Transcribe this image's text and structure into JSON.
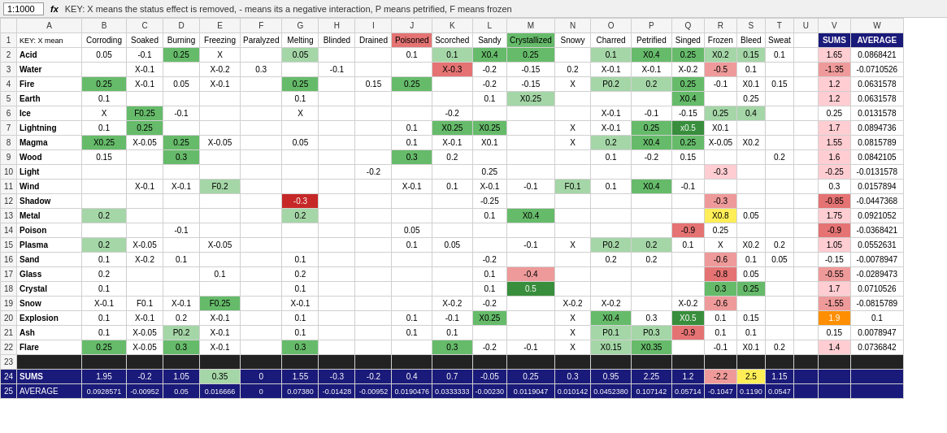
{
  "toolbar": {
    "zoom": "1:1000",
    "fx_label": "fx",
    "formula": "KEY: X means the status effect is removed, - means its a negative interaction, P means petrified, F means frozen"
  },
  "col_headers": [
    "",
    "A",
    "B",
    "C",
    "D",
    "E",
    "F",
    "G",
    "H",
    "I",
    "J",
    "K",
    "L",
    "M",
    "N",
    "O",
    "P",
    "Q",
    "R",
    "S",
    "T",
    "U",
    "V",
    "W"
  ],
  "row1_headers": [
    "KEY: X mean",
    "Corroding",
    "Soaked",
    "Burning",
    "Freezing",
    "Paralyzed",
    "Melting",
    "Blinded",
    "Drained",
    "Poisoned",
    "Scorched",
    "Sandy",
    "Crystallized",
    "Snowy",
    "Charred",
    "Petrified",
    "Singed",
    "Frozen",
    "Bleed",
    "Sweat",
    "",
    "SUMS",
    "AVERAGE"
  ],
  "rows": [
    {
      "num": 2,
      "label": "Acid",
      "cells": {
        "B": "0.05",
        "C": "-0.1",
        "D": "0.25",
        "E": "X",
        "G": "0.05",
        "J": "0.1",
        "K": "0.1",
        "L": "X.0.4",
        "M": "0.25",
        "O": "0.1",
        "P": "X0.4",
        "Q": "0.25",
        "R": "X0.2",
        "S": "0.15",
        "T": "0.1",
        "V": "1.65",
        "W": "0.0868421"
      },
      "colors": {
        "D": "g2",
        "G": "g1",
        "K": "g1",
        "L": "g2",
        "M": "g2",
        "O": "g1",
        "P": "g2",
        "Q": "g2",
        "R": "g1",
        "S": "g1"
      }
    },
    {
      "num": 3,
      "label": "Water",
      "cells": {
        "C": "X-0.1",
        "E": "X-0.2",
        "F": "0.3",
        "H": "-0.1",
        "K": "X-0.3",
        "L": "-0.2",
        "M": "-0.15",
        "N": "0.2",
        "O": "X-0.1",
        "P": "X-0.1",
        "Q": "X-0.2",
        "R": "-0.5",
        "S": "0.1",
        "V": "-1.35",
        "W": "-0.071052"
      },
      "colors": {
        "K": "r3",
        "R": "r2",
        "V": "r2"
      }
    },
    {
      "num": 4,
      "label": "Fire",
      "cells": {
        "B": "0.25",
        "C": "X-0.1",
        "D": "0.05",
        "E": "X-0.1",
        "G": "0.25",
        "I": "0.15",
        "J": "0.25",
        "L": "-0.2",
        "M": "-0.15",
        "N": "X",
        "O": "P0.2",
        "P": "0.2",
        "Q": "0.25",
        "R": "-0.1",
        "S": "X0.1",
        "T": "0.15",
        "V": "1.2",
        "W": "0.0631578"
      },
      "colors": {
        "B": "g2",
        "G": "g2",
        "J": "g2",
        "O": "g1",
        "P": "g1",
        "Q": "g2"
      }
    },
    {
      "num": 5,
      "label": "Earth",
      "cells": {
        "B": "0.1",
        "G": "0.1",
        "L": "0.1",
        "M": "X0.25",
        "Q": "X0.4",
        "S": "0.25",
        "V": "1.2",
        "W": "0.0631578"
      },
      "colors": {
        "M": "g1",
        "Q": "g2"
      }
    },
    {
      "num": 6,
      "label": "Ice",
      "cells": {
        "B": "X",
        "C": "F0.25",
        "D": "-0.1",
        "G": "X",
        "K": "-0.2",
        "O": "X-0.1",
        "P": "-0.1",
        "Q": "-0.15",
        "R": "0.25",
        "S": "0.4",
        "V": "0.25",
        "W": "0.0131578"
      },
      "colors": {
        "C": "g2",
        "R": "g2",
        "S": "g2"
      }
    },
    {
      "num": 7,
      "label": "Lightning",
      "cells": {
        "B": "0.1",
        "C": "0.25",
        "J": "0.1",
        "K": "X0.25",
        "L": "X0.25",
        "N": "X",
        "O": "X-0.1",
        "P": "0.25",
        "Q": "x0.5",
        "R": "X0.1",
        "V": "1.7",
        "W": "0.0894736"
      },
      "colors": {
        "C": "g2",
        "K": "g2",
        "L": "g2",
        "P": "g2",
        "Q": "g3"
      }
    },
    {
      "num": 8,
      "label": "Magma",
      "cells": {
        "B": "X0.25",
        "C": "X-0.05",
        "D": "0.25",
        "E": "X-0.05",
        "G": "0.05",
        "J": "0.1",
        "K": "X-0.1",
        "L": "X0.1",
        "N": "X",
        "O": "0.2",
        "P": "X0.4",
        "Q": "0.25",
        "R": "X-0.05",
        "S": "X0.2",
        "V": "1.55",
        "W": "0.0815789"
      },
      "colors": {
        "B": "g2",
        "D": "g2",
        "O": "g1",
        "P": "g2",
        "Q": "g2"
      }
    },
    {
      "num": 9,
      "label": "Wood",
      "cells": {
        "B": "0.15",
        "D": "0.3",
        "J": "0.3",
        "K": "0.2",
        "O": "0.1",
        "P": "-0.2",
        "Q": "0.15",
        "T": "0.2",
        "V": "1.6",
        "W": "0.0842105"
      },
      "colors": {
        "D": "g2",
        "J": "g2"
      }
    },
    {
      "num": 10,
      "label": "Light",
      "cells": {
        "I": "-0.2",
        "L": "0.25",
        "R": "-0.3",
        "V": "-0.25",
        "W": "-0.013157"
      },
      "colors": {
        "R": "r1"
      }
    },
    {
      "num": 11,
      "label": "Wind",
      "cells": {
        "C": "X-0.1",
        "D": "X-0.1",
        "E": "F0.2",
        "J": "X-0.1",
        "K": "0.1",
        "L": "X-0.1",
        "M": "-0.1",
        "N": "F0.1",
        "O": "0.1",
        "P": "X0.4",
        "Q": "-0.1",
        "V": "0.3",
        "W": "0.0157894"
      },
      "colors": {
        "E": "g1",
        "P": "g2"
      }
    },
    {
      "num": 12,
      "label": "Shadow",
      "cells": {
        "G": "-0.3",
        "L": "-0.25",
        "R": "-0.3",
        "V": "-0.85",
        "W": "-0.044736"
      },
      "colors": {
        "G": "r3",
        "R": "r2",
        "V": "r3"
      }
    },
    {
      "num": 13,
      "label": "Metal",
      "cells": {
        "B": "0.2",
        "G": "0.2",
        "L": "0.1",
        "M": "X0.4",
        "R": "X0.8",
        "S": "0.05",
        "V": "1.75",
        "W": "0.0921052"
      },
      "colors": {
        "B": "g1",
        "G": "g1",
        "M": "g2",
        "R": "yellow"
      }
    },
    {
      "num": 14,
      "label": "Poison",
      "cells": {
        "D": "-0.1",
        "J": "0.05",
        "Q": "-0.9",
        "R": "0.25",
        "V": "-0.9",
        "W": "-0.036842"
      },
      "colors": {
        "Q": "r3"
      }
    },
    {
      "num": 15,
      "label": "Plasma",
      "cells": {
        "B": "0.2",
        "C": "X-0.05",
        "E": "X-0.05",
        "J": "0.1",
        "K": "0.05",
        "M": "-0.1",
        "N": "X",
        "O": "P0.2",
        "P": "0.2",
        "Q": "0.1",
        "R": "X",
        "S": "X0.2",
        "T": "0.2",
        "V": "1.05",
        "W": "0.0552631"
      },
      "colors": {
        "B": "g1",
        "O": "g1",
        "P": "g1"
      }
    },
    {
      "num": 16,
      "label": "Sand",
      "cells": {
        "B": "0.1",
        "C": "X-0.2",
        "D": "0.1",
        "G": "0.1",
        "L": "-0.2",
        "O": "0.2",
        "P": "0.2",
        "R": "-0.6",
        "S": "0.1",
        "T": "0.05",
        "V": "-0.15",
        "W": "-0.007894"
      },
      "colors": {
        "R": "r2"
      }
    },
    {
      "num": 17,
      "label": "Glass",
      "cells": {
        "B": "0.2",
        "E": "0.1",
        "G": "0.2",
        "L": "0.1",
        "M": "-0.4",
        "R": "-0.8",
        "S": "0.05",
        "V": "-0.55",
        "W": "-0.028947"
      },
      "colors": {
        "M": "r2",
        "R": "r3"
      }
    },
    {
      "num": 18,
      "label": "Crystal",
      "cells": {
        "B": "0.1",
        "G": "0.1",
        "L": "0.1",
        "M": "0.5",
        "R": "0.3",
        "S": "0.25",
        "V": "1.7",
        "W": "0.0710526"
      },
      "colors": {
        "M": "g3",
        "R": "g2",
        "S": "g2"
      }
    },
    {
      "num": 19,
      "label": "Snow",
      "cells": {
        "B": "X-0.1",
        "C": "F0.1",
        "D": "X-0.1",
        "E": "F0.25",
        "G": "X-0.1",
        "K": "X-0.2",
        "L": "-0.2",
        "N": "X-0.2",
        "O": "X-0.2",
        "Q": "X-0.2",
        "R": "-0.6",
        "V": "-1.55",
        "W": "-0.081578"
      },
      "colors": {
        "E": "g2",
        "R": "r2",
        "V": "r2"
      }
    },
    {
      "num": 20,
      "label": "Explosion",
      "cells": {
        "B": "0.1",
        "C": "X-0.1",
        "D": "0.2",
        "E": "X-0.1",
        "G": "0.1",
        "J": "0.1",
        "K": "-0.1",
        "L": "X0.25",
        "N": "X",
        "O": "X0.4",
        "P": "0.3",
        "Q": "X0.5",
        "R": "0.1",
        "S": "0.15",
        "V": "1.9",
        "W": "0.1"
      },
      "colors": {
        "L": "g2",
        "O": "g2",
        "Q": "g3",
        "V": "orange"
      }
    },
    {
      "num": 21,
      "label": "Ash",
      "cells": {
        "B": "0.1",
        "C": "X-0.05",
        "D": "P0.2",
        "E": "X-0.1",
        "G": "0.1",
        "J": "0.1",
        "K": "0.1",
        "N": "X",
        "O": "P0.1",
        "P": "P0.3",
        "Q": "-0.9",
        "R": "0.1",
        "S": "0.1",
        "V": "0.15",
        "W": "0.0078947"
      },
      "colors": {
        "D": "g1",
        "O": "g1",
        "P": "g1",
        "Q": "r3"
      }
    },
    {
      "num": 22,
      "label": "Flare",
      "cells": {
        "B": "0.25",
        "C": "X-0.05",
        "D": "0.3",
        "E": "X-0.1",
        "G": "0.3",
        "K": "0.3",
        "L": "-0.2",
        "M": "-0.1",
        "N": "X",
        "O": "X0.15",
        "P": "X0.35",
        "R": "-0.1",
        "S": "X0.1",
        "T": "0.2",
        "V": "1.4",
        "W": "0.0736842"
      },
      "colors": {
        "B": "g2",
        "D": "g2",
        "G": "g2",
        "K": "g2",
        "O": "g1",
        "P": "g2"
      }
    },
    {
      "num": 24,
      "label_class": "sums-label",
      "label": "SUMS",
      "cells": {
        "B": "1.95",
        "C": "-0.2",
        "D": "1.05",
        "E": "0.35",
        "F": "0",
        "G": "1.55",
        "H": "-0.3",
        "I": "-0.2",
        "J": "0.4",
        "K": "0.7",
        "L": "-0.05",
        "M": "0.25",
        "N": "0.3",
        "O": "0.95",
        "P": "2.25",
        "Q": "1.2",
        "R": "-2.2",
        "S": "2.5",
        "T": "1.15",
        "V": "",
        "W": ""
      },
      "colors": {
        "E": "g1",
        "R": "r2",
        "S": "yellow"
      }
    },
    {
      "num": 25,
      "label_class": "avg-label",
      "label": "AVERAGE",
      "cells": {
        "B": "0.0928571",
        "C": "-0.00952",
        "D": "0.05",
        "E": "0.016666",
        "F": "0",
        "G": "0.07380",
        "H": "-0.01428",
        "I": "-0.00952",
        "J": "0.0190476",
        "K": "0.0333333",
        "L": "-0.00230",
        "M": "0.0119047",
        "N": "0.010142",
        "O": "0.0452380",
        "P": "0.107142",
        "Q": "0.05714",
        "R": "-0.1047",
        "S": "0.1190",
        "T": "0.0547",
        "V": "",
        "W": ""
      },
      "colors": {}
    }
  ]
}
